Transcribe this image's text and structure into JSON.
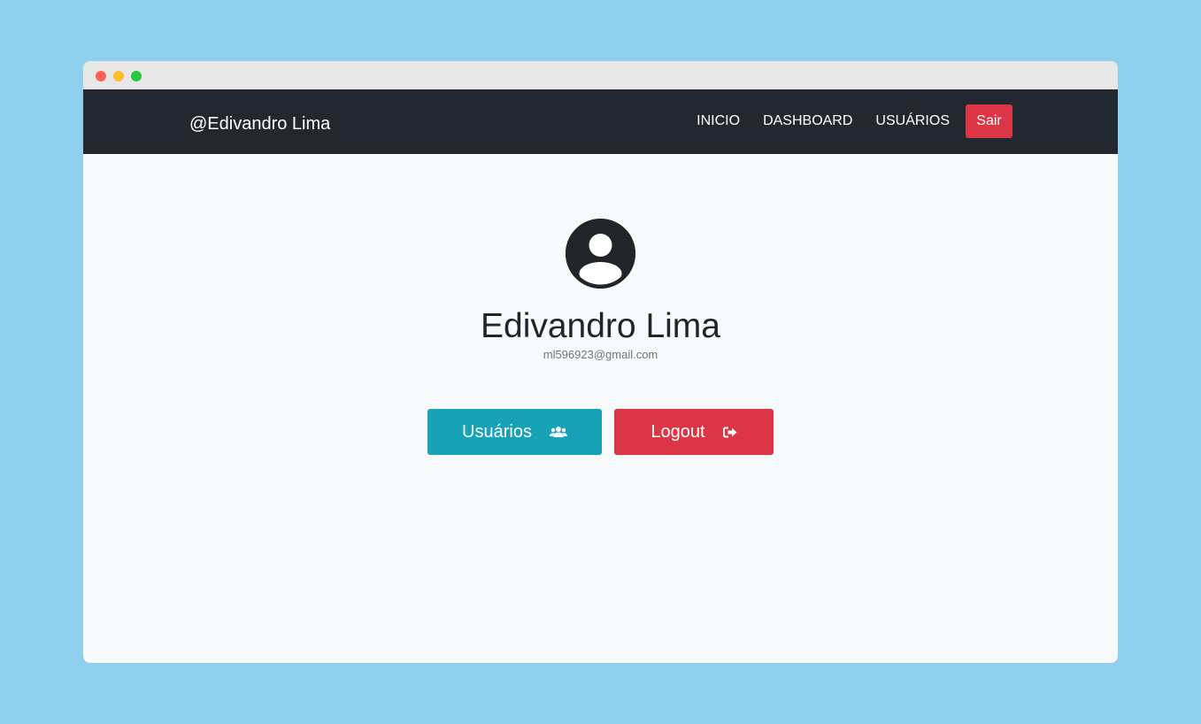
{
  "navbar": {
    "brand": "@Edivandro Lima",
    "links": [
      "INICIO",
      "DASHBOARD",
      "USUÁRIOS"
    ],
    "logout_label": "Sair"
  },
  "profile": {
    "avatar_icon": "user-circle-icon",
    "name": "Edivandro Lima",
    "email": "ml596923@gmail.com"
  },
  "actions": {
    "users_label": "Usuários",
    "users_icon": "users-icon",
    "logout_label": "Logout",
    "logout_icon": "sign-out-icon"
  },
  "colors": {
    "navbar_bg": "#232830",
    "primary_info": "#17a2b8",
    "danger": "#dc3545",
    "page_bg": "#f8f9fb"
  }
}
